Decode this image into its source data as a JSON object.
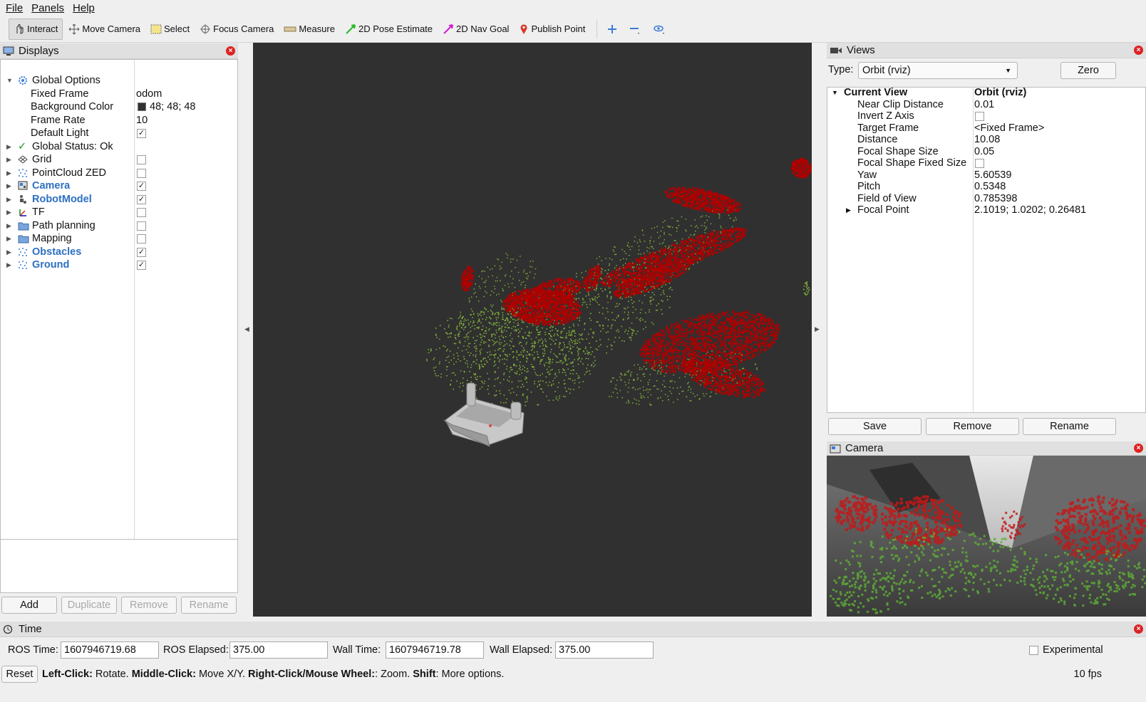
{
  "menu": {
    "file": "File",
    "panels": "Panels",
    "help": "Help"
  },
  "toolbar": {
    "interact": "Interact",
    "move_camera": "Move Camera",
    "select": "Select",
    "focus_camera": "Focus Camera",
    "measure": "Measure",
    "pose_estimate": "2D Pose Estimate",
    "nav_goal": "2D Nav Goal",
    "publish_point": "Publish Point"
  },
  "displays": {
    "title": "Displays",
    "global_options": "Global Options",
    "props": [
      {
        "label": "Fixed Frame",
        "value": "odom"
      },
      {
        "label": "Background Color",
        "value": "48; 48; 48"
      },
      {
        "label": "Frame Rate",
        "value": "10"
      },
      {
        "label": "Default Light",
        "value": ""
      }
    ],
    "global_status": "Global Status: Ok",
    "items": [
      {
        "label": "Grid",
        "checked": false,
        "highlight": false,
        "icon": "grid-icon"
      },
      {
        "label": "PointCloud ZED",
        "checked": false,
        "highlight": false,
        "icon": "pointcloud-icon"
      },
      {
        "label": "Camera",
        "checked": true,
        "highlight": true,
        "icon": "camera-icon"
      },
      {
        "label": "RobotModel",
        "checked": true,
        "highlight": true,
        "icon": "robot-icon"
      },
      {
        "label": "TF",
        "checked": false,
        "highlight": false,
        "icon": "tf-icon"
      },
      {
        "label": "Path planning",
        "checked": false,
        "highlight": false,
        "icon": "folder-icon"
      },
      {
        "label": "Mapping",
        "checked": false,
        "highlight": false,
        "icon": "folder-icon"
      },
      {
        "label": "Obstacles",
        "checked": true,
        "highlight": true,
        "icon": "pointcloud-icon"
      },
      {
        "label": "Ground",
        "checked": true,
        "highlight": true,
        "icon": "pointcloud-icon"
      }
    ],
    "buttons": {
      "add": "Add",
      "duplicate": "Duplicate",
      "remove": "Remove",
      "rename": "Rename"
    }
  },
  "views": {
    "title": "Views",
    "type_label": "Type:",
    "type_value": "Orbit (rviz)",
    "zero": "Zero",
    "current_view": "Current View",
    "current_view_value": "Orbit (rviz)",
    "props": [
      {
        "label": "Near Clip Distance",
        "value": "0.01"
      },
      {
        "label": "Invert Z Axis",
        "value": ""
      },
      {
        "label": "Target Frame",
        "value": "<Fixed Frame>"
      },
      {
        "label": "Distance",
        "value": "10.08"
      },
      {
        "label": "Focal Shape Size",
        "value": "0.05"
      },
      {
        "label": "Focal Shape Fixed Size",
        "value": ""
      },
      {
        "label": "Yaw",
        "value": "5.60539"
      },
      {
        "label": "Pitch",
        "value": "0.5348"
      },
      {
        "label": "Field of View",
        "value": "0.785398"
      },
      {
        "label": "Focal Point",
        "value": "2.1019; 1.0202; 0.26481"
      }
    ],
    "save": "Save",
    "remove": "Remove",
    "rename": "Rename"
  },
  "camera": {
    "title": "Camera"
  },
  "time": {
    "title": "Time",
    "ros_time_label": "ROS Time:",
    "ros_time": "1607946719.68",
    "ros_elapsed_label": "ROS Elapsed:",
    "ros_elapsed": "375.00",
    "wall_time_label": "Wall Time:",
    "wall_time": "1607946719.78",
    "wall_elapsed_label": "Wall Elapsed:",
    "wall_elapsed": "375.00",
    "experimental": "Experimental"
  },
  "status": {
    "reset": "Reset",
    "left_click": "Left-Click:",
    "left_click_desc": " Rotate. ",
    "middle_click": "Middle-Click:",
    "middle_click_desc": " Move X/Y. ",
    "right_click": "Right-Click/Mouse Wheel:",
    "right_click_desc": ": Zoom. ",
    "shift": "Shift",
    "shift_desc": ": More options.",
    "fps": "10 fps"
  },
  "colors": {
    "background": "#303030",
    "obstacles": "#b00000",
    "ground": "#7fae3a",
    "highlight": "#2d6fc2"
  }
}
